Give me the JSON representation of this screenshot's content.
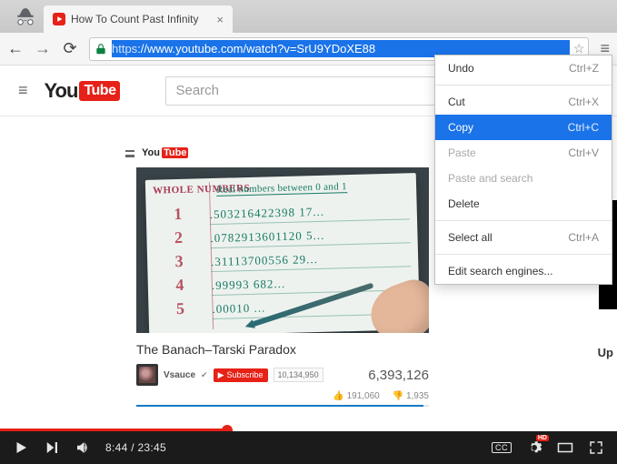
{
  "browser": {
    "tab_title": "How To Count Past Infinity",
    "url_scheme": "https",
    "url_rest": "://www.youtube.com/watch?v=SrU9YDoXE88",
    "search_placeholder": "Search"
  },
  "logo": {
    "you": "You",
    "tube": "Tube"
  },
  "context_menu": {
    "undo": "Undo",
    "undo_sc": "Ctrl+Z",
    "cut": "Cut",
    "cut_sc": "Ctrl+X",
    "copy": "Copy",
    "copy_sc": "Ctrl+C",
    "paste": "Paste",
    "paste_sc": "Ctrl+V",
    "paste_search": "Paste and search",
    "delete": "Delete",
    "select_all": "Select all",
    "select_all_sc": "Ctrl+A",
    "edit_engines": "Edit search engines..."
  },
  "video": {
    "title": "The Banach–Tarski Paradox",
    "channel": "Vsauce",
    "subscribe": "Subscribe",
    "sub_count": "10,134,950",
    "views": "6,393,126",
    "likes": "191,060",
    "dislikes": "1,935",
    "thumb": {
      "header_left": "WHOLE NUMBERS",
      "header_right": "Real numbers between 0 and 1",
      "rows": [
        {
          "n": "1",
          "v": ".503216422398 17..."
        },
        {
          "n": "2",
          "v": ".0782913601120 5..."
        },
        {
          "n": "3",
          "v": ".31113700556 29..."
        },
        {
          "n": "4",
          "v": ".99993       682..."
        },
        {
          "n": "5",
          "v": ".00010 ..."
        }
      ]
    }
  },
  "player": {
    "time": "8:44 / 23:45",
    "cc": "CC",
    "hd": "HD"
  },
  "sidebar": {
    "up_next": "Up"
  }
}
